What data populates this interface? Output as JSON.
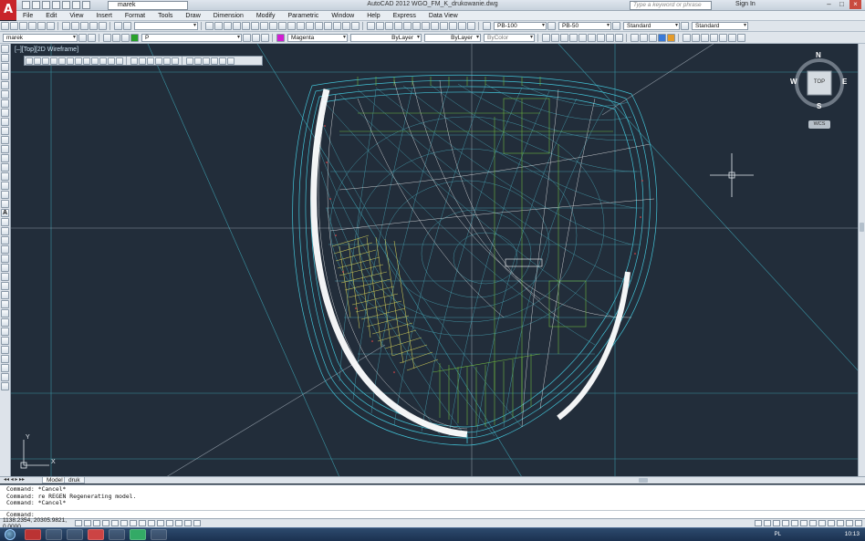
{
  "window": {
    "title": "AutoCAD 2012   WGO_FM_K_drukowanie.dwg",
    "workspace": "marek",
    "search_placeholder": "Type a keyword or phrase",
    "sign_in": "Sign In",
    "min_label": "–",
    "max_label": "□",
    "close_label": "×"
  },
  "menu": [
    "File",
    "Edit",
    "View",
    "Insert",
    "Format",
    "Tools",
    "Draw",
    "Dimension",
    "Modify",
    "Parametric",
    "Window",
    "Help",
    "Express",
    "Data View"
  ],
  "toolbar1": {
    "text_style": "PB-100",
    "dim_style": "PB-50",
    "table_style": "Standard",
    "mleader_style": "Standard"
  },
  "toolbar2": {
    "layer": "marek",
    "layer_current": "P",
    "color": "Magenta",
    "linetype": "ByLayer",
    "lineweight": "ByLayer",
    "plotstyle": "ByColor"
  },
  "viewport": {
    "label": "[–][Top][2D Wireframe]",
    "viewcube": {
      "top_face": "TOP",
      "north": "N",
      "south": "S",
      "east": "E",
      "west": "W",
      "ucs": "WCS"
    },
    "ucs_x": "X",
    "ucs_y": "Y"
  },
  "layout_tabs": [
    "Model",
    "druk"
  ],
  "command_lines": [
    "Command: *Cancel*",
    "Command: re REGEN Regenerating model.",
    "Command: *Cancel*"
  ],
  "command_prompt": "Command:",
  "status": {
    "coordinates": "1138.2354, 20305.9821, 0.0000"
  },
  "taskbar": {
    "language": "PL",
    "time": "10:13"
  },
  "colors": {
    "canvas": "#222d3a",
    "wire_cyan": "#43c4d8",
    "wire_white": "#ffffff",
    "wire_green": "#6fb83f",
    "wire_yellow": "#d7d45a",
    "logo_red": "#c8242a"
  },
  "icons": [
    "autocad-logo-icon",
    "new-icon",
    "open-icon",
    "save-icon",
    "undo-icon",
    "redo-icon",
    "plot-icon",
    "search-icon",
    "viewcube-icon",
    "crosshair-icon",
    "ucs-icon",
    "windows-start-icon"
  ]
}
